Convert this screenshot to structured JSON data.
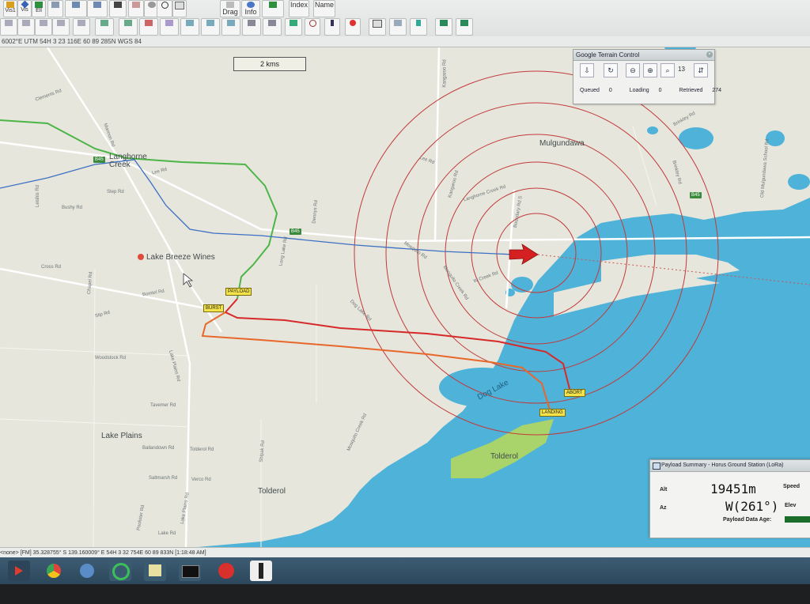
{
  "toolbar": {
    "row1": [
      "Drag",
      "Info",
      "Index",
      "Name"
    ],
    "row1_small": [
      "Vis1",
      "Vis",
      "Ell"
    ]
  },
  "coord_bar": "6002°E  UTM 54H  3 23 116E  60 89 285N  WGS 84",
  "map": {
    "scale_label": "2 kms",
    "towns": {
      "langhorne": "Langhorne\nCreek",
      "lake_breeze": "Lake Breeze Wines",
      "mulgundawa": "Mulgundawa",
      "lake_plains": "Lake Plains",
      "dog_lake": "Dog Lake",
      "tolderol_w": "Tolderol",
      "tolderol_e": "Tolderol"
    },
    "roads": {
      "kangaroo": "Kangaroo Rd",
      "clements": "Clements Rd",
      "mannon": "Mannon Rd",
      "lee": "Lee Rd",
      "lee2": "Lee Rd",
      "step": "Step Rd",
      "bushy": "Bushy Rd",
      "leishis": "Leishis Rd",
      "dennys": "Dennys Rd",
      "long_lake": "Long Lake Rd",
      "kangaroo2": "Kangaroo Rd",
      "langhorne_creek_rd": "Langhorne Creek Rd",
      "mosquito": "Mosquito Rd",
      "mosquito_creek": "Mosquito Creek Rd",
      "w_creek": "W Creek Rd",
      "boundary": "Boundary Rd S",
      "cross": "Cross Rd",
      "chapel": "Chapel Rd",
      "bomtel": "Bomtel Rd",
      "slip": "Slip Rd",
      "dog_lake_rd": "Dog Lake Rd",
      "woodstock": "Woodstock Rd",
      "lake_plains_rd": "Lake Plains Rd",
      "tavemer": "Tavemer Rd",
      "ballandown": "Ballandown Rd",
      "tolderol_rd": "Tolderol Rd",
      "saltmarsh": "Saltmarsh Rd",
      "verco": "Verco Rd",
      "lake_plains_rd2": "Lake Plains Rd",
      "poolister": "Poolister Rd",
      "shipak": "Shipak Rd",
      "lake_rd": "Lake Rd",
      "mosquito_creek2": "Mosquito Creek Rd",
      "brinkley": "Brinkley Rd",
      "brinkley2": "Brinkley Rd",
      "old_mulgundawa": "Old Mulgundawa School Rd"
    },
    "shields": {
      "b45a": "B45",
      "b45b": "B45",
      "b45c": "B45"
    },
    "tags": {
      "payload": "PAYLOAD",
      "burst": "BURST",
      "abort": "ABORT",
      "landing": "LANDING"
    }
  },
  "terrain": {
    "title": "Google Terrain Control",
    "zoom": "13",
    "queued_label": "Queued",
    "queued": "0",
    "loading_label": "Loading",
    "loading": "0",
    "retrieved_label": "Retrieved",
    "retrieved": "274"
  },
  "payload": {
    "title": "Payload Summary - Horus Ground Station (LoRa)",
    "alt_label": "Alt",
    "alt": "19451m",
    "speed_label": "Speed",
    "az_label": "Az",
    "az": "W(261°)",
    "elev_label": "Elev",
    "age_label": "Payload Data Age:"
  },
  "status": "<none>          [FM] 35.328755° S   139.160009° E   54H   3 32 754E   60 89 833N   [1:18:48 AM]",
  "colors": {
    "water": "#4fb2d8",
    "land": "#e6e6dc",
    "green_track": "#4db548",
    "blue_track": "#3d6fc4",
    "red_track": "#d62a2a",
    "orange_track": "#e8672a",
    "range_ring": "#c23a3a"
  }
}
